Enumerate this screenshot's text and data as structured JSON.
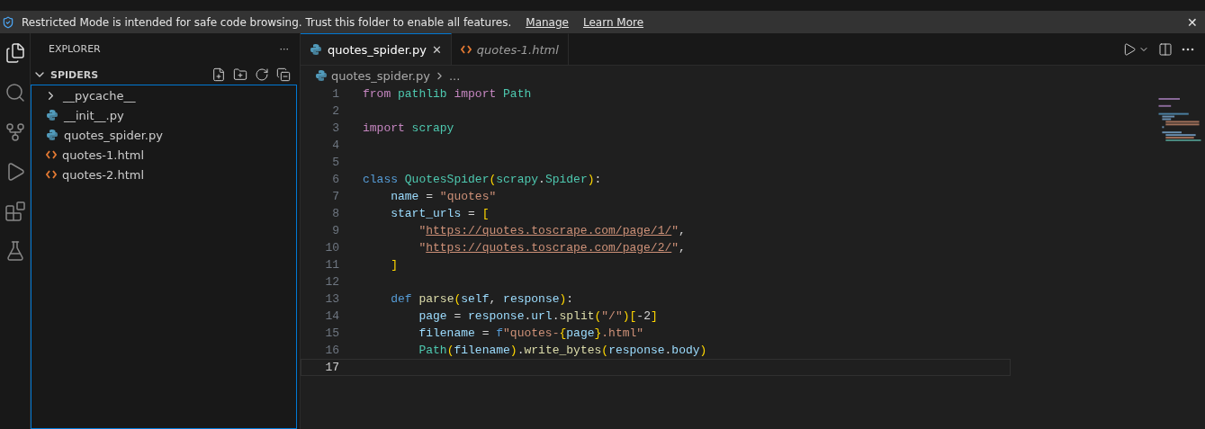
{
  "banner": {
    "message": "Restricted Mode is intended for safe code browsing. Trust this folder to enable all features.",
    "links": [
      "Manage",
      "Learn More"
    ],
    "close": "✕"
  },
  "activity_bar": [
    {
      "kind": "files",
      "selected": true
    },
    {
      "kind": "search",
      "selected": false
    },
    {
      "kind": "branch",
      "selected": false
    },
    {
      "kind": "run",
      "selected": false
    },
    {
      "kind": "extensions",
      "selected": false
    },
    {
      "kind": "testing",
      "selected": false
    }
  ],
  "sidebar": {
    "title": "EXPLORER",
    "more": "···",
    "section": {
      "title": "SPIDERS",
      "expanded": true
    },
    "items": [
      {
        "name": "__pycache__",
        "kind": "folder",
        "expanded": false
      },
      {
        "name": "__init__.py",
        "kind": "python"
      },
      {
        "name": "quotes_spider.py",
        "kind": "python"
      },
      {
        "name": "quotes-1.html",
        "kind": "html"
      },
      {
        "name": "quotes-2.html",
        "kind": "html"
      }
    ]
  },
  "tabs": [
    {
      "label": "quotes_spider.py",
      "kind": "python",
      "selected": true,
      "preview": false,
      "close": "✕"
    },
    {
      "label": "quotes-1.html",
      "kind": "html",
      "selected": false,
      "preview": true
    }
  ],
  "breadcrumb": {
    "file": "quotes_spider.py",
    "rest": "..."
  },
  "lines": [
    {
      "number": "1",
      "current": false,
      "tokens": [
        {
          "kind": "kw",
          "text": "from "
        },
        {
          "kind": "cls",
          "text": "pathlib "
        },
        {
          "kind": "kw",
          "text": "import "
        },
        {
          "kind": "cls",
          "text": "Path"
        }
      ]
    },
    {
      "number": "2",
      "current": false
    },
    {
      "number": "3",
      "current": false,
      "tokens": [
        {
          "kind": "kw",
          "text": "import "
        },
        {
          "kind": "cls",
          "text": "scrapy"
        }
      ]
    },
    {
      "number": "4",
      "current": false
    },
    {
      "number": "5",
      "current": false
    },
    {
      "number": "6",
      "current": false,
      "tokens": [
        {
          "kind": "decl",
          "text": "class "
        },
        {
          "kind": "cls",
          "text": "QuotesSpider"
        },
        {
          "kind": "br1",
          "text": "("
        },
        {
          "kind": "cls",
          "text": "scrapy"
        },
        {
          "kind": "plain",
          "text": "."
        },
        {
          "kind": "cls",
          "text": "Spider"
        },
        {
          "kind": "br1",
          "text": ")"
        },
        {
          "kind": "plain",
          "text": ":"
        }
      ]
    },
    {
      "number": "7",
      "current": false,
      "tokens": [
        {
          "kind": "var",
          "text": "    name"
        },
        {
          "kind": "plain",
          "text": " = "
        },
        {
          "kind": "str",
          "text": "\"quotes\""
        }
      ]
    },
    {
      "number": "8",
      "current": false,
      "tokens": [
        {
          "kind": "var",
          "text": "    start_urls"
        },
        {
          "kind": "plain",
          "text": " = "
        },
        {
          "kind": "br1",
          "text": "["
        }
      ]
    },
    {
      "number": "9",
      "current": false,
      "tokens": [
        {
          "kind": "str",
          "text": "        \""
        },
        {
          "kind": "url",
          "text": "https://quotes.toscrape.com/page/1/"
        },
        {
          "kind": "str",
          "text": "\""
        },
        {
          "kind": "plain",
          "text": ","
        }
      ]
    },
    {
      "number": "10",
      "current": false,
      "tokens": [
        {
          "kind": "str",
          "text": "        \""
        },
        {
          "kind": "url",
          "text": "https://quotes.toscrape.com/page/2/"
        },
        {
          "kind": "str",
          "text": "\""
        },
        {
          "kind": "plain",
          "text": ","
        }
      ]
    },
    {
      "number": "11",
      "current": false,
      "tokens": [
        {
          "kind": "br1",
          "text": "    ]"
        }
      ]
    },
    {
      "number": "12",
      "current": false
    },
    {
      "number": "13",
      "current": false,
      "tokens": [
        {
          "kind": "decl",
          "text": "    def "
        },
        {
          "kind": "fn",
          "text": "parse"
        },
        {
          "kind": "br1",
          "text": "("
        },
        {
          "kind": "var",
          "text": "self"
        },
        {
          "kind": "plain",
          "text": ", "
        },
        {
          "kind": "var",
          "text": "response"
        },
        {
          "kind": "br1",
          "text": ")"
        },
        {
          "kind": "plain",
          "text": ":"
        }
      ]
    },
    {
      "number": "14",
      "current": false,
      "tokens": [
        {
          "kind": "var",
          "text": "        page"
        },
        {
          "kind": "plain",
          "text": " = "
        },
        {
          "kind": "var",
          "text": "response"
        },
        {
          "kind": "plain",
          "text": "."
        },
        {
          "kind": "var",
          "text": "url"
        },
        {
          "kind": "plain",
          "text": "."
        },
        {
          "kind": "fn",
          "text": "split"
        },
        {
          "kind": "br1",
          "text": "("
        },
        {
          "kind": "str",
          "text": "\"/\""
        },
        {
          "kind": "br1",
          "text": ")["
        },
        {
          "kind": "plain",
          "text": "-2"
        },
        {
          "kind": "br1",
          "text": "]"
        }
      ]
    },
    {
      "number": "15",
      "current": false,
      "tokens": [
        {
          "kind": "var",
          "text": "        filename"
        },
        {
          "kind": "plain",
          "text": " = "
        },
        {
          "kind": "decl",
          "text": "f"
        },
        {
          "kind": "str",
          "text": "\"quotes-"
        },
        {
          "kind": "br1",
          "text": "{"
        },
        {
          "kind": "var",
          "text": "page"
        },
        {
          "kind": "br1",
          "text": "}"
        },
        {
          "kind": "str",
          "text": ".html\""
        }
      ]
    },
    {
      "number": "16",
      "current": false,
      "tokens": [
        {
          "kind": "cls",
          "text": "        Path"
        },
        {
          "kind": "br1",
          "text": "("
        },
        {
          "kind": "var",
          "text": "filename"
        },
        {
          "kind": "br1",
          "text": ")"
        },
        {
          "kind": "plain",
          "text": "."
        },
        {
          "kind": "fn",
          "text": "write_bytes"
        },
        {
          "kind": "br1",
          "text": "("
        },
        {
          "kind": "var",
          "text": "response"
        },
        {
          "kind": "plain",
          "text": "."
        },
        {
          "kind": "var",
          "text": "body"
        },
        {
          "kind": "br1",
          "text": ")"
        }
      ]
    },
    {
      "number": "17",
      "current": true
    }
  ]
}
